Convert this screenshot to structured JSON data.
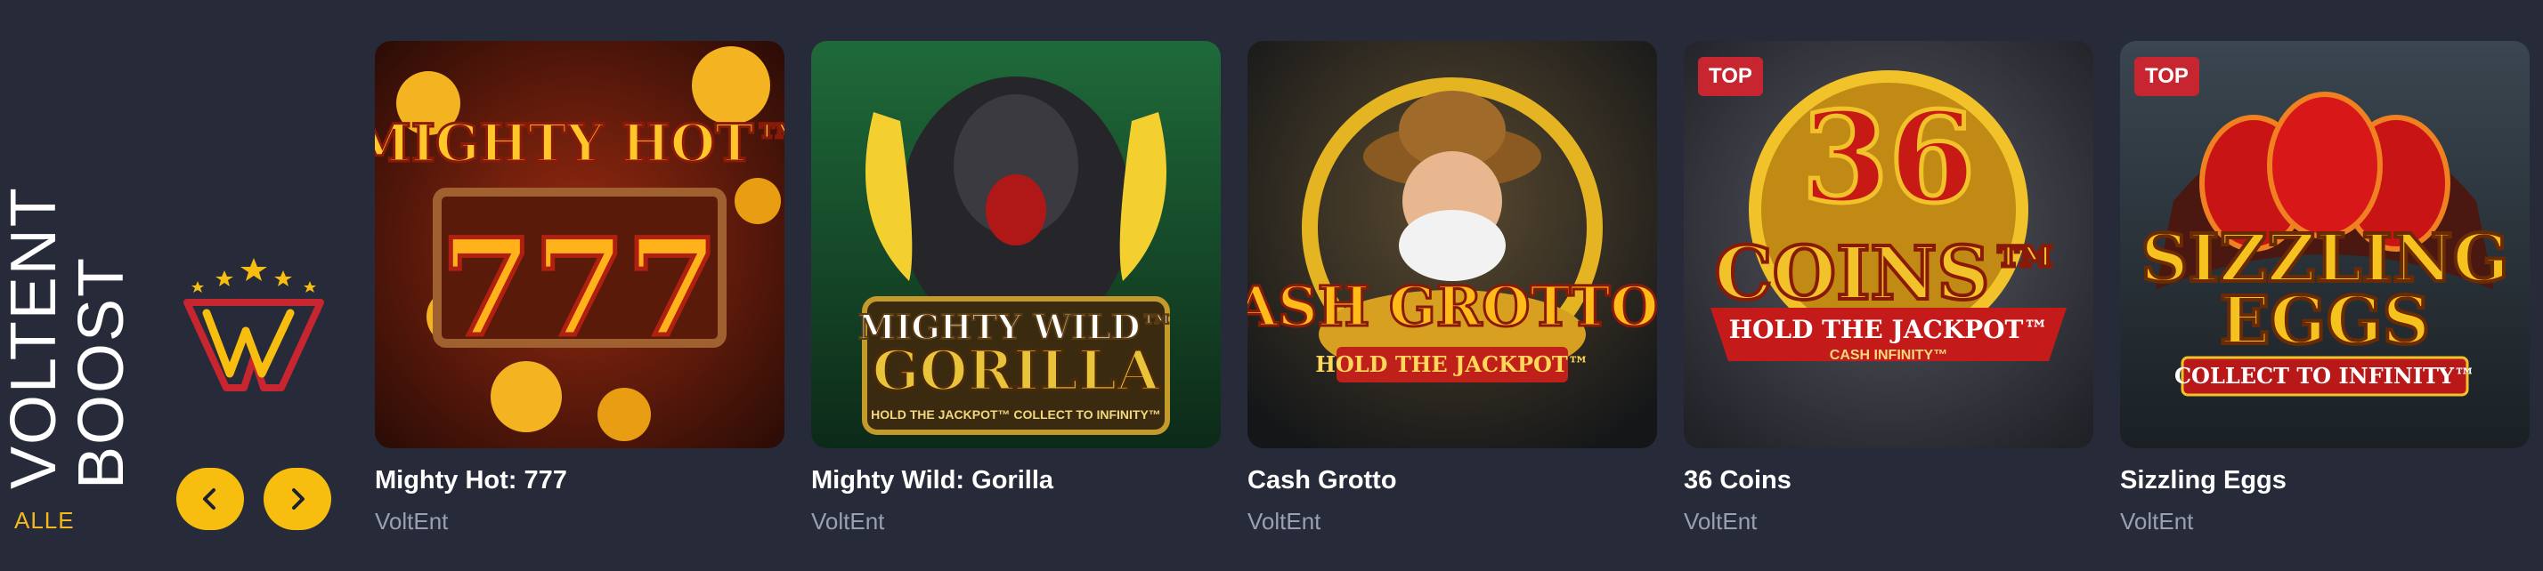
{
  "section": {
    "title_line1": "VOLTENT",
    "title_line2": "BOOST",
    "all_label": "ALLE"
  },
  "nav": {
    "prev_icon": "chevron-left-icon",
    "next_icon": "chevron-right-icon"
  },
  "colors": {
    "accent": "#f7be10",
    "badge": "#c72530",
    "background": "#272a39"
  },
  "games": [
    {
      "title": "Mighty Hot: 777",
      "provider": "VoltEnt",
      "badge": "",
      "art_line1": "MIGHTY HOT™",
      "art_line2": "777",
      "art_line3": ""
    },
    {
      "title": "Mighty Wild: Gorilla",
      "provider": "VoltEnt",
      "badge": "",
      "art_line1": "MIGHTY WILD™",
      "art_line2": "GORILLA",
      "art_line3": "HOLD THE JACKPOT™ COLLECT TO INFINITY™"
    },
    {
      "title": "Cash Grotto",
      "provider": "VoltEnt",
      "badge": "",
      "art_line1": "CASH GROTTO™",
      "art_line2": "HOLD THE JACKPOT™",
      "art_line3": ""
    },
    {
      "title": "36 Coins",
      "provider": "VoltEnt",
      "badge": "TOP",
      "art_line1": "36",
      "art_line2": "COINS™",
      "art_line3": "HOLD THE JACKPOT™",
      "art_line4": "CASH INFINITY™"
    },
    {
      "title": "Sizzling Eggs",
      "provider": "VoltEnt",
      "badge": "TOP",
      "art_line1": "SIZZLING",
      "art_line2": "EGGS",
      "art_line3": "COLLECT TO INFINITY™"
    }
  ]
}
